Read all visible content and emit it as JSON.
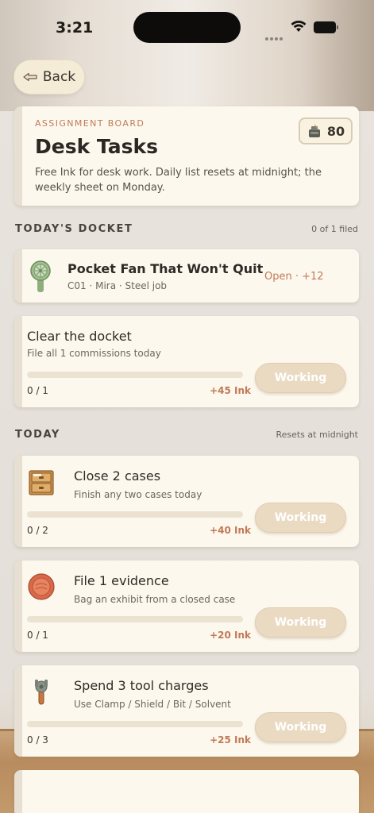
{
  "status_bar": {
    "time": "3:21"
  },
  "nav": {
    "back_label": "Back"
  },
  "header": {
    "eyebrow": "ASSIGNMENT BOARD",
    "title": "Desk Tasks",
    "description": "Free Ink for desk work. Daily list resets at midnight; the weekly sheet on Monday.",
    "ink_balance": "80"
  },
  "docket": {
    "section_title": "TODAY'S DOCKET",
    "section_meta": "0 of 1 filed",
    "item": {
      "title": "Pocket Fan That Won't Quit",
      "subtitle": "C01 · Mira · Steel job",
      "status": "Open · +12",
      "icon": "pocket-fan-icon"
    },
    "goal": {
      "title": "Clear the docket",
      "subtitle": "File all 1 commissions today",
      "progress_text": "0 / 1",
      "progress": 0,
      "reward": "+45 Ink",
      "button": "Working"
    }
  },
  "today": {
    "section_title": "TODAY",
    "section_meta": "Resets at midnight",
    "tasks": [
      {
        "title": "Close 2 cases",
        "subtitle": "Finish any two cases today",
        "progress_text": "0 / 2",
        "progress": 0,
        "reward": "+40 Ink",
        "button": "Working",
        "icon": "cabinet-icon"
      },
      {
        "title": "File 1 evidence",
        "subtitle": "Bag an exhibit from a closed case",
        "progress_text": "0 / 1",
        "progress": 0,
        "reward": "+20 Ink",
        "button": "Working",
        "icon": "evidence-dish-icon"
      },
      {
        "title": "Spend 3 tool charges",
        "subtitle": "Use Clamp / Shield / Bit / Solvent",
        "progress_text": "0 / 3",
        "progress": 0,
        "reward": "+25 Ink",
        "button": "Working",
        "icon": "clamp-tool-icon"
      }
    ]
  },
  "colors": {
    "accent": "#c07a55",
    "card": "#fdf8ee",
    "button": "#eadac2"
  }
}
